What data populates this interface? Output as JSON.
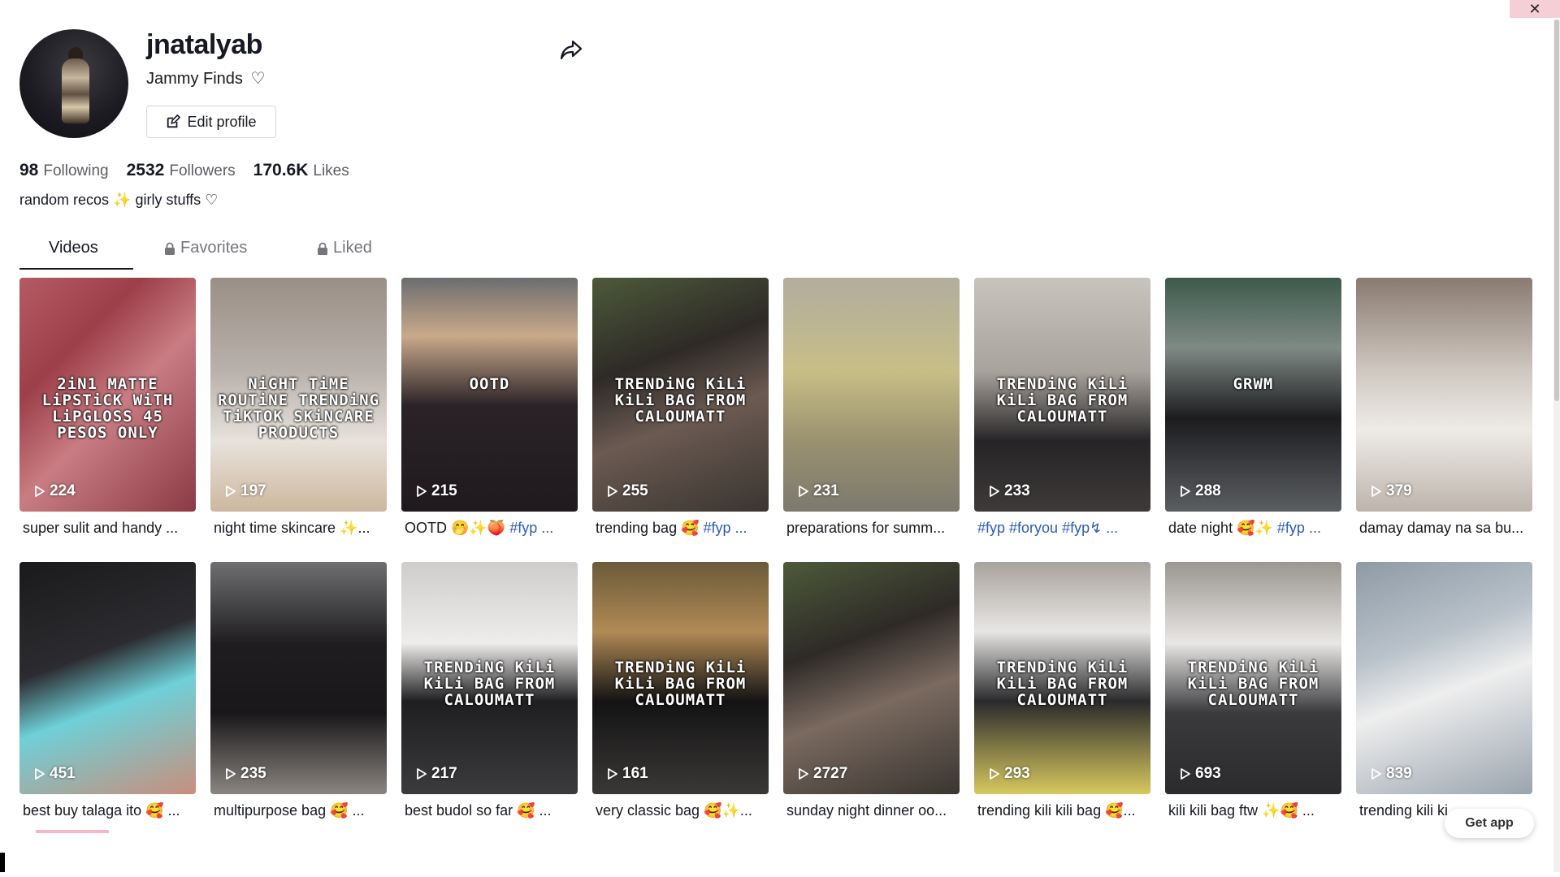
{
  "window": {
    "close_label": "✕"
  },
  "profile": {
    "username": "jnatalyab",
    "nickname": "Jammy Finds",
    "edit_label": "Edit profile",
    "stats": [
      {
        "value": "98",
        "label": "Following"
      },
      {
        "value": "2532",
        "label": "Followers"
      },
      {
        "value": "170.6K",
        "label": "Likes"
      }
    ],
    "bio": "random recos ✨ girly stuffs ♡"
  },
  "tabs": [
    {
      "label": "Videos",
      "active": true
    },
    {
      "label": "Favorites",
      "locked": true
    },
    {
      "label": "Liked",
      "locked": true
    }
  ],
  "videos": [
    {
      "plays": "224",
      "caption": "super sulit and handy ...",
      "overlay": "2iN1 MATTE LiPSTiCK WiTH LiPGLOSS 45 PESOS ONLY",
      "bg": "linear-gradient(135deg,#b55a63 0%,#9d3f49 30%,#c97c83 55%,#8a3a44 100%)"
    },
    {
      "plays": "197",
      "caption": "night time skincare ✨...",
      "overlay": "NiGHT TiME ROUTiNE TRENDiNG TiKTOK SKiNCARE PRODUCTS",
      "bg": "linear-gradient(180deg,#9a8f86 0%,#b9b1ab 40%,#e8e2dc 70%,#cdb79d 100%)"
    },
    {
      "plays": "215",
      "caption": "OOTD 🤭✨🍑",
      "hashtag": "#fyp ...",
      "overlay": "OOTD",
      "bg": "linear-gradient(180deg,#6b6d70 0%,#c9a98b 25%,#2a2227 55%,#1f1a1e 100%)"
    },
    {
      "plays": "255",
      "caption": "trending bag 🥰",
      "hashtag": "#fyp ...",
      "overlay": "TRENDiNG KiLi KiLi BAG FROM CALOUMATT",
      "bg": "linear-gradient(160deg,#4d5a3a 0%,#2e2a27 35%,#6b5a52 60%,#3a3530 100%)"
    },
    {
      "plays": "231",
      "caption": "preparations for summ...",
      "overlay": "",
      "bg": "linear-gradient(180deg,#b2ad9f 0%,#c7be86 40%,#9a9170 70%,#7c796e 100%)"
    },
    {
      "plays": "233",
      "caption": "",
      "hashtag": "#fyp #foryou #fyp↯ ...",
      "overlay": "TRENDiNG KiLi KiLi BAG FROM CALOUMATT",
      "bg": "linear-gradient(180deg,#c9c3bd 0%,#a9a39d 40%,#262426 70%,#3e3a39 100%)"
    },
    {
      "plays": "288",
      "caption": "date night 🥰✨",
      "hashtag": "#fyp ...",
      "overlay": "GRWM",
      "bg": "linear-gradient(180deg,#3c5a4c 0%,#7f8a85 30%,#1c1c1f 60%,#5b5e61 100%)"
    },
    {
      "plays": "379",
      "caption": "damay damay na sa bu...",
      "overlay": "",
      "bg": "linear-gradient(180deg,#8a7a70 0%,#cfc8c1 40%,#eeebe7 65%,#bdb4ab 100%)"
    },
    {
      "plays": "451",
      "caption": "best buy talaga ito 🥰 ...",
      "overlay": "",
      "bg": "linear-gradient(160deg,#1a1a1c 0%,#2c2c30 40%,#6ed0d8 60%,#c88f7d 100%)"
    },
    {
      "plays": "235",
      "caption": "multipurpose bag 🥰 ...",
      "overlay": "",
      "bg": "linear-gradient(180deg,#6f6f72 0%,#1f1d20 35%,#191719 65%,#8a8580 100%)"
    },
    {
      "plays": "217",
      "caption": "best budol so far 🥰 ...",
      "overlay": "TRENDiNG KiLi KiLi BAG FROM CALOUMATT",
      "bg": "linear-gradient(180deg,#cfcdcb 0%,#efedeb 35%,#1f1e20 60%,#3b3a3c 100%)"
    },
    {
      "plays": "161",
      "caption": "very classic bag 🥰✨...",
      "overlay": "TRENDiNG KiLi KiLi BAG FROM CALOUMATT",
      "bg": "linear-gradient(180deg,#6b5a3a 0%,#b08a55 30%,#141314 60%,#3a3836 100%)"
    },
    {
      "plays": "2727",
      "caption": "sunday night dinner oo...",
      "overlay": "",
      "bg": "linear-gradient(160deg,#4d5a3a 0%,#2e2a27 35%,#7a6a60 60%,#3a3530 100%)"
    },
    {
      "plays": "293",
      "caption": "trending kili kili bag 🥰...",
      "overlay": "TRENDiNG KiLi KiLi BAG FROM CALOUMATT",
      "bg": "linear-gradient(180deg,#a9a39d 0%,#e8e6e4 30%,#2a2a2c 60%,#d7c85e 100%)"
    },
    {
      "plays": "693",
      "caption": "kili kili bag ftw ✨🥰 ...",
      "overlay": "TRENDiNG KiLi KiLi BAG FROM CALOUMATT",
      "bg": "linear-gradient(180deg,#9a9690 0%,#e9e7e5 35%,#3a3a3d 65%,#2b2a2c 100%)"
    },
    {
      "plays": "839",
      "caption": "trending kili ki...",
      "overlay": "",
      "bg": "linear-gradient(160deg,#8e9aa6 0%,#b9c2ca 35%,#eeeeee 55%,#9aa4ae 100%)"
    }
  ],
  "get_app_label": "Get app"
}
